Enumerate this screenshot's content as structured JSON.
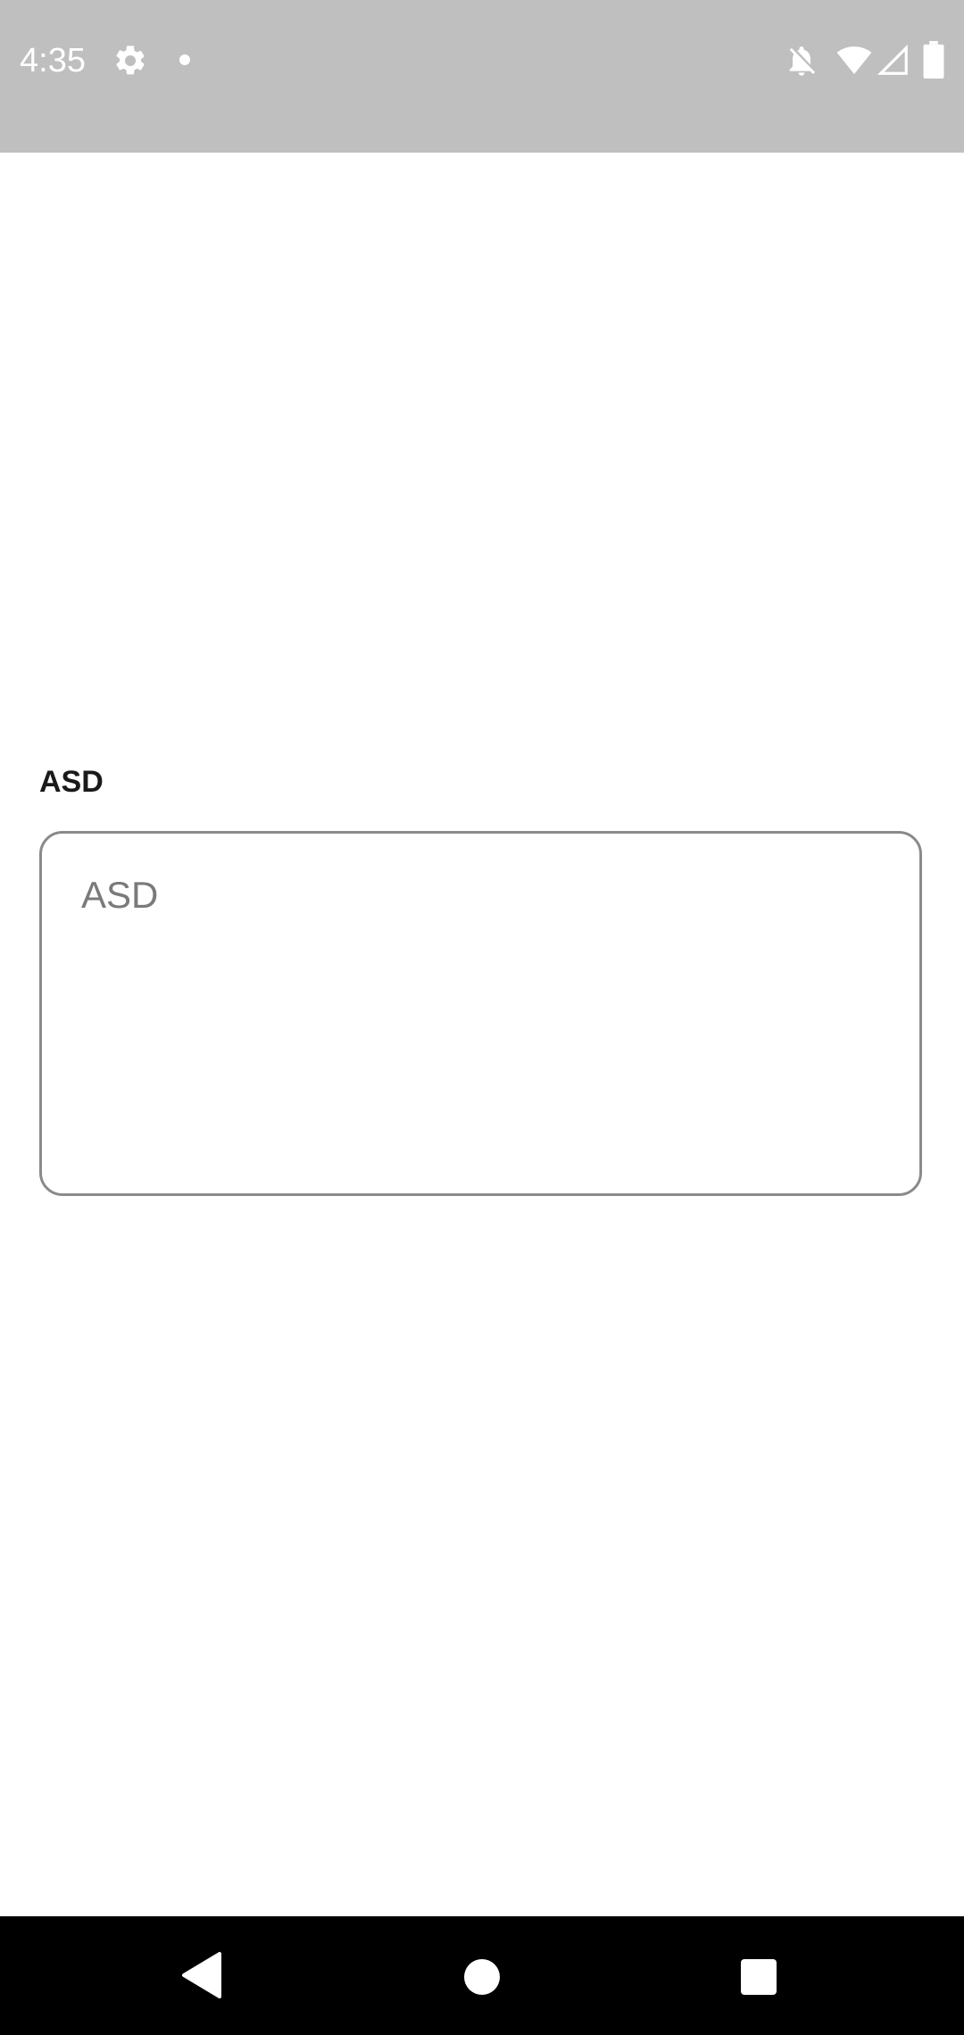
{
  "status_bar": {
    "time": "4:35",
    "icons": [
      "settings-icon",
      "notification-dot-icon",
      "notifications-off-icon",
      "wifi-icon",
      "cell-signal-icon",
      "battery-icon"
    ]
  },
  "form": {
    "label": "ASD",
    "placeholder": "ASD",
    "value": ""
  },
  "nav_bar": {
    "buttons": [
      "back-icon",
      "home-icon",
      "recents-icon"
    ]
  },
  "colors": {
    "status_bar_bg": "#bfbfbf",
    "nav_bar_bg": "#000000",
    "border": "#8a8a8a",
    "placeholder": "#7a7a7a"
  }
}
